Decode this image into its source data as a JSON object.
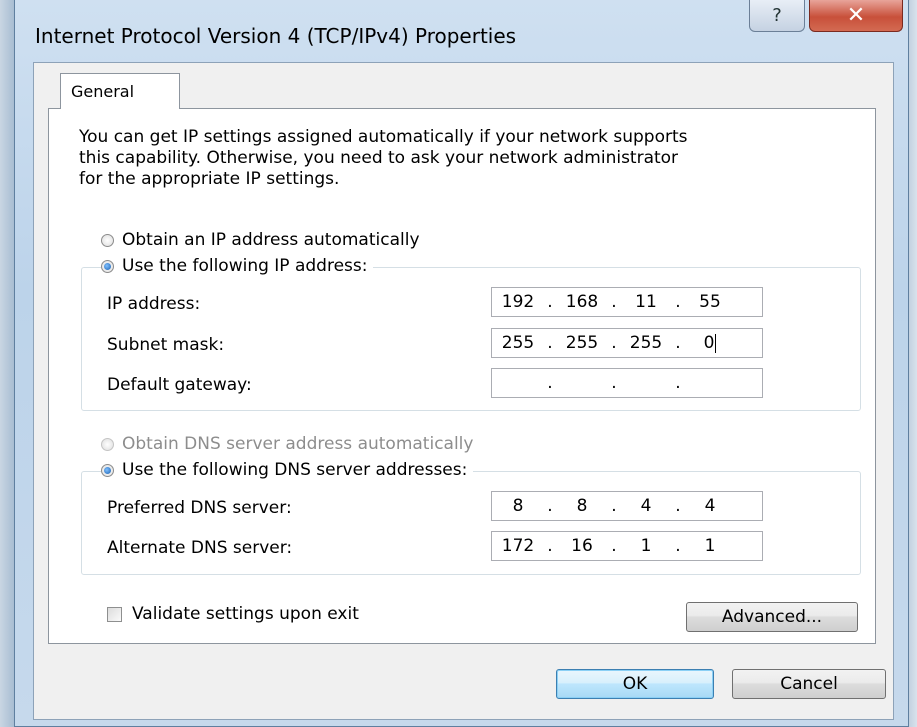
{
  "window": {
    "title": "Internet Protocol Version 4 (TCP/IPv4) Properties",
    "help_glyph": "?",
    "close_glyph": "✕"
  },
  "tabs": [
    {
      "label": "General"
    }
  ],
  "description": "You can get IP settings assigned automatically if your network supports\nthis capability. Otherwise, you need to ask your network administrator\nfor the appropriate IP settings.",
  "ip_section": {
    "auto_label": "Obtain an IP address automatically",
    "manual_label": "Use the following IP address:",
    "selected": "manual",
    "fields": [
      {
        "label": "IP address:",
        "octets": [
          "192",
          "168",
          "11",
          "55"
        ]
      },
      {
        "label": "Subnet mask:",
        "octets": [
          "255",
          "255",
          "255",
          "0"
        ]
      },
      {
        "label": "Default gateway:",
        "octets": [
          "",
          "",
          "",
          ""
        ]
      }
    ]
  },
  "dns_section": {
    "auto_label": "Obtain DNS server address automatically",
    "manual_label": "Use the following DNS server addresses:",
    "selected": "manual",
    "auto_disabled": true,
    "fields": [
      {
        "label": "Preferred DNS server:",
        "octets": [
          "8",
          "8",
          "4",
          "4"
        ]
      },
      {
        "label": "Alternate DNS server:",
        "octets": [
          "172",
          "16",
          "1",
          "1"
        ]
      }
    ]
  },
  "validate_checkbox": {
    "label": "Validate settings upon exit",
    "checked": false
  },
  "buttons": {
    "advanced": "Advanced...",
    "ok": "OK",
    "cancel": "Cancel"
  },
  "separator": "."
}
